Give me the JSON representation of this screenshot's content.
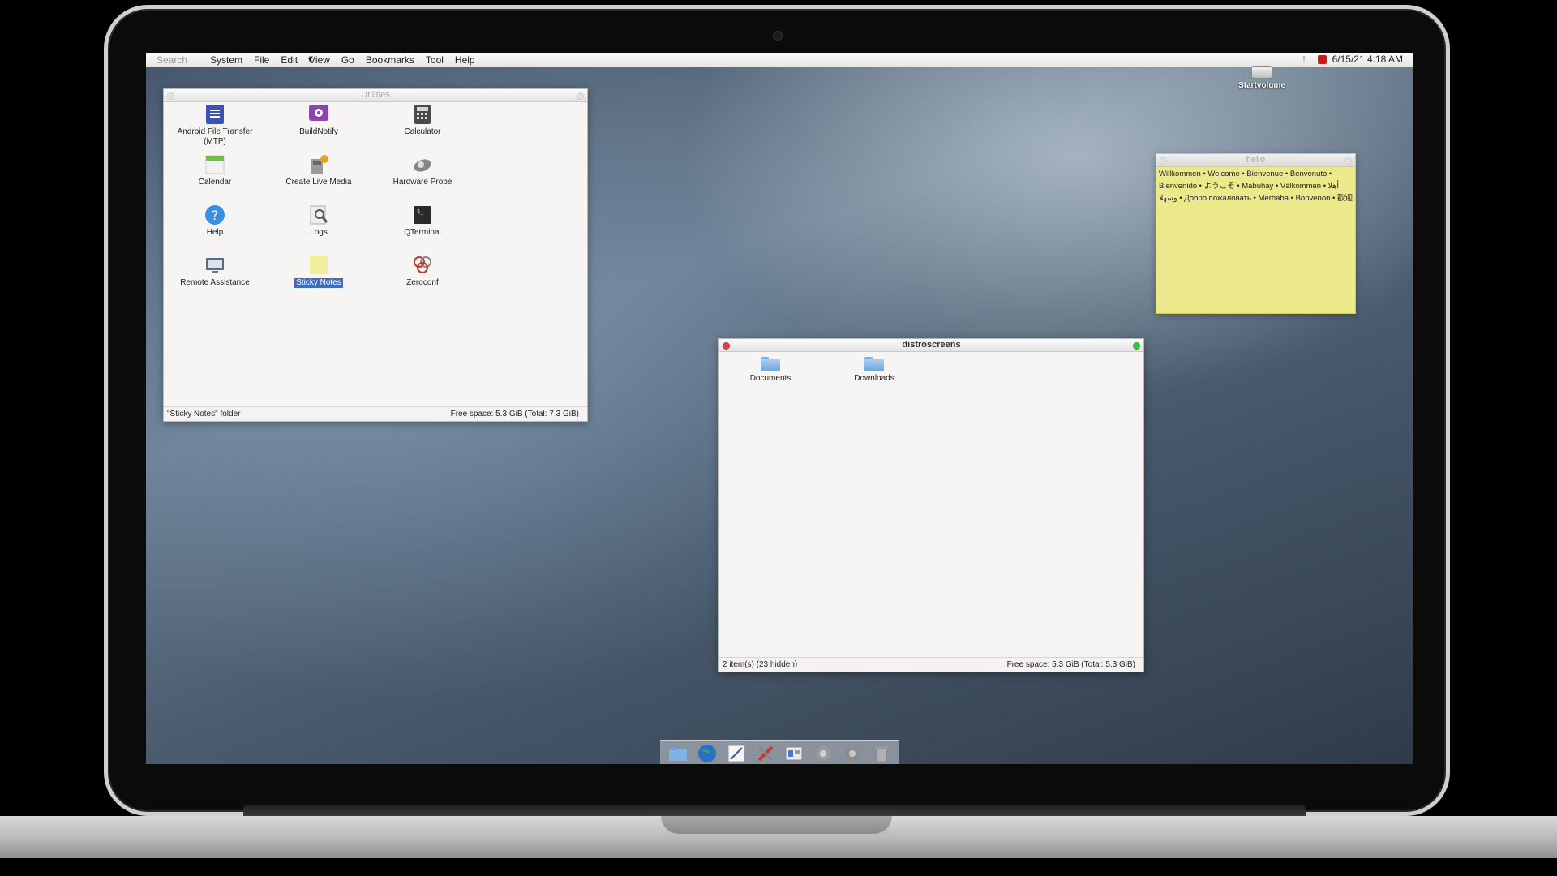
{
  "menubar": {
    "search_placeholder": "Search",
    "items": [
      "System",
      "File",
      "Edit",
      "View",
      "Go",
      "Bookmarks",
      "Tool",
      "Help"
    ],
    "datetime": "6/15/21 4:18 AM",
    "record_color": "#d01a1a"
  },
  "desktop": {
    "volume_label": "Startvolume"
  },
  "utilities": {
    "title": "Utilities",
    "apps": [
      {
        "label": "Android File Transfer (MTP)",
        "icon": "file-transfer-icon"
      },
      {
        "label": "BuildNotify",
        "icon": "buildnotify-icon"
      },
      {
        "label": "Calculator",
        "icon": "calculator-icon"
      },
      {
        "label": "Calendar",
        "icon": "calendar-icon"
      },
      {
        "label": "Create Live Media",
        "icon": "live-media-icon"
      },
      {
        "label": "Hardware Probe",
        "icon": "hardware-probe-icon"
      },
      {
        "label": "Help",
        "icon": "help-icon"
      },
      {
        "label": "Logs",
        "icon": "logs-icon"
      },
      {
        "label": "QTerminal",
        "icon": "terminal-icon"
      },
      {
        "label": "Remote Assistance",
        "icon": "remote-assistance-icon"
      },
      {
        "label": "Sticky Notes",
        "icon": "sticky-notes-icon",
        "selected": true
      },
      {
        "label": "Zeroconf",
        "icon": "zeroconf-icon"
      }
    ],
    "status_left": "\"Sticky Notes\" folder",
    "status_right": "Free space: 5.3 GiB (Total: 7.3 GiB)"
  },
  "sticky": {
    "title": "hello",
    "text": "Willkommen • Welcome • Bienvenue • Benvenuto • Bienvenido • ようこそ • Mabuhay • Välkommen • أهلا وسهلا • Добро пожаловать • Merhaba • Bonvenon • 歡迎"
  },
  "distroscreens": {
    "title": "distroscreens",
    "folders": [
      "Documents",
      "Downloads"
    ],
    "status_left": "2 item(s) (23 hidden)",
    "status_right": "Free space: 5.3 GiB (Total: 5.3 GiB)",
    "close_color": "#e0443e",
    "zoom_color": "#3cc33c"
  },
  "dock": {
    "items": [
      "folder-icon",
      "globe-icon",
      "text-editor-icon",
      "tools-icon",
      "windows-icon",
      "settings-icon",
      "preferences-icon",
      "trash-icon"
    ]
  }
}
